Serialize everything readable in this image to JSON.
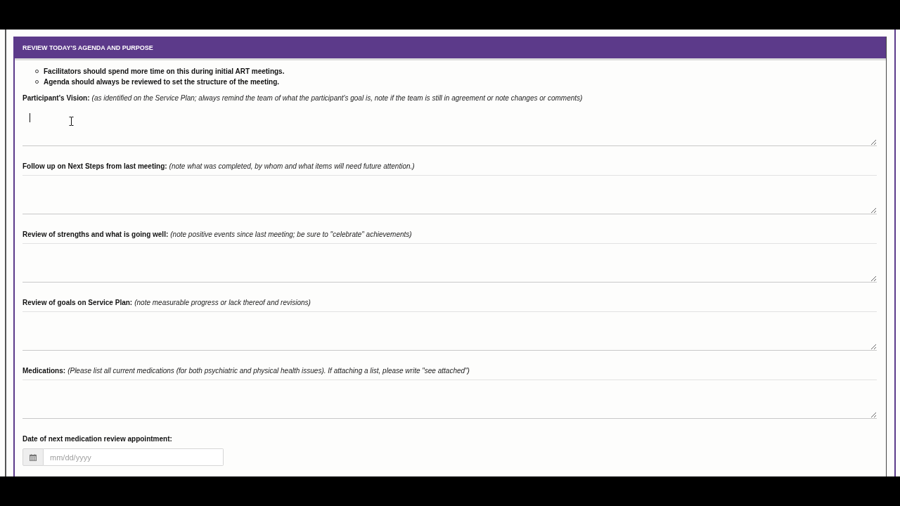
{
  "panel": {
    "title": "REVIEW TODAY'S AGENDA AND PURPOSE",
    "bullets": [
      "Facilitators should spend more time on this during initial ART meetings.",
      "Agenda should always be reviewed to set the structure of the meeting."
    ],
    "fields": [
      {
        "kind": "textarea",
        "label": "Participant's Vision:",
        "hint": "(as identified on the Service Plan; always remind the team of what the participant's goal is, note if the team is still in agreement or note changes or comments)",
        "focused": true
      },
      {
        "kind": "textarea",
        "label": "Follow up on Next Steps from last meeting:",
        "hint": "(note what was completed, by whom and what items will need future attention.)",
        "focused": false
      },
      {
        "kind": "textarea",
        "label": "Review of strengths and what is going well:",
        "hint": "(note positive events since last meeting; be sure to \"celebrate\" achievements)",
        "focused": false
      },
      {
        "kind": "textarea",
        "label": "Review of goals on Service Plan:",
        "hint": "(note measurable progress or lack thereof and revisions)",
        "focused": false
      },
      {
        "kind": "textarea",
        "label": "Medications:",
        "hint": "(Please list all current medications (for both psychiatric and physical health issues). If attaching a list, please write \"see attached\")",
        "focused": false
      },
      {
        "kind": "date",
        "label": "Date of next medication review appointment:",
        "placeholder": "mm/dd/yyyy"
      }
    ]
  }
}
